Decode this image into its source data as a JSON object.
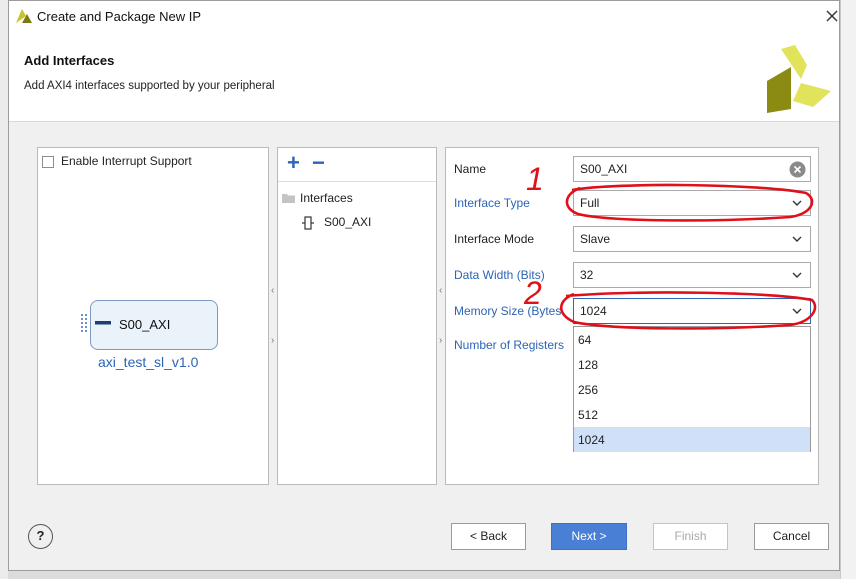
{
  "dialog": {
    "title": "Create and Package New IP",
    "header_title": "Add Interfaces",
    "header_subtitle": "Add AXI4 interfaces supported by your peripheral"
  },
  "left_panel": {
    "interrupt_label": "Enable Interrupt Support",
    "interrupt_checked": false,
    "block_label": "S00_AXI",
    "ip_name": "axi_test_sl_v1.0"
  },
  "middle_panel": {
    "add_symbol": "+",
    "remove_symbol": "−",
    "tree_root": "Interfaces",
    "tree_child": "S00_AXI"
  },
  "right_panel": {
    "name_label": "Name",
    "name_value": "S00_AXI",
    "interface_type_label": "Interface Type",
    "interface_type_value": "Full",
    "interface_mode_label": "Interface Mode",
    "interface_mode_value": "Slave",
    "data_width_label": "Data Width (Bits)",
    "data_width_value": "32",
    "memory_size_label": "Memory Size (Bytes",
    "memory_size_value": "1024",
    "num_registers_label": "Number of Registers",
    "memory_size_options": [
      "64",
      "128",
      "256",
      "512",
      "1024"
    ],
    "memory_size_selected": "1024"
  },
  "annotations": {
    "mark_1": "1",
    "mark_2": "2",
    "color": "#e0101a"
  },
  "footer": {
    "help_symbol": "?",
    "back_label": "< Back",
    "next_label": "Next >",
    "finish_label": "Finish",
    "cancel_label": "Cancel"
  },
  "colors": {
    "accent": "#4a7fd6",
    "link_label": "#2c64b6",
    "selected_option": "#cfe0f8",
    "logo_yellow": "#e6e85a",
    "logo_olive": "#8a8a12"
  }
}
